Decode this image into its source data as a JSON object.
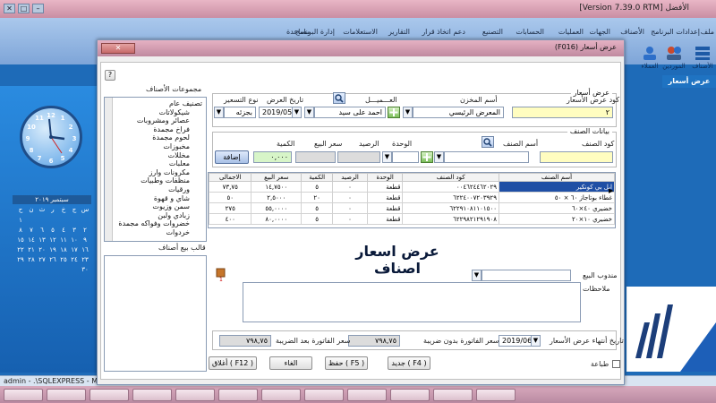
{
  "app": {
    "title": "[Version 7.39.0 RTM] الأفضل",
    "menu_items": [
      "ملف",
      "إعدادات البرنامج",
      "الأصناف",
      "الجهات",
      "العمليات",
      "الحسابات",
      "التصنيع",
      "دعم اتخاذ قرار",
      "التقارير",
      "الاستعلامات",
      "إدارة البرنامج",
      "مساعدة"
    ],
    "ribbon": [
      "الأصناف",
      "الموردين",
      "العملاء"
    ],
    "ribbon_tab": "عرض أسعار",
    "status_text": "admin  -  .\\SQLEXPRESS  -  Marke",
    "calendar": {
      "header": "سبتمبر ٢٠١٩",
      "weekdays": [
        "س",
        "ج",
        "خ",
        "ر",
        "ث",
        "ن",
        "ح"
      ],
      "days": [
        "",
        "",
        "",
        "",
        "",
        "",
        "١",
        "٢",
        "٣",
        "٤",
        "٥",
        "٦",
        "٧",
        "٨",
        "٩",
        "١٠",
        "١١",
        "١٢",
        "١٣",
        "١٤",
        "١٥",
        "١٦",
        "١٧",
        "١٨",
        "١٩",
        "٢٠",
        "٢١",
        "٢٢",
        "٢٣",
        "٢٤",
        "٢٥",
        "٢٦",
        "٢٧",
        "٢٨",
        "٢٩",
        "٣٠"
      ]
    },
    "clock_numbers": [
      "12",
      "1",
      "2",
      "3",
      "4",
      "5",
      "6",
      "7",
      "8",
      "9",
      "10",
      "11"
    ]
  },
  "dialog": {
    "title": "(F016) عرض أسعار",
    "help": "?",
    "header_group": {
      "caption": "عرض أسعار",
      "code_label": "كود عرض الأسعار",
      "code_value": "٢",
      "store_label": "أسم المخزن",
      "store_value": "المعرض الرئيسي",
      "customer_label": "العـــميـــل",
      "customer_value": "احمد على سيد",
      "date_label": "تاريخ العرض",
      "date_value": "2019/05/14",
      "pricing_label": "نوع التسعير",
      "pricing_value": "بجزئه"
    },
    "item_group": {
      "caption": "بيانات الصنف",
      "item_code_label": "كود الصنف",
      "item_name_label": "أسم الصنف",
      "unit_label": "الوحدة",
      "balance_label": "الرصيد",
      "price_label": "سعر البيع",
      "qty_label": "الكمية",
      "qty_value": "٠,٠٠٠",
      "add_button": "إضافة"
    },
    "grid": {
      "columns": [
        "أسم الصنف",
        "كود الصنف",
        "الوحدة",
        "الرصيد",
        "الكمية",
        "سعر البيع",
        "الاجمالى"
      ],
      "rows": [
        [
          "ايل بي كونكير",
          "٠٠٤٦٢٤٤٦٢٠٢٩",
          "قطعة",
          "٠",
          "٥",
          "١٤,٧٥٠٠",
          "٧٣,٧٥"
        ],
        [
          "غطاء بوتاجاز ٦٠ × ٥٠",
          "٦٢٢٤٠٠٧٢٠٣٩٢٩",
          "قطعة",
          "٠",
          "٢٠",
          "٢,٥٠٠٠",
          "٥٠"
        ],
        [
          "خضيري ٤٠×٦٠",
          "٦٢٢٩١٠٨١١٠١٥٠٠",
          "قطعة",
          "٠",
          "٥",
          "٥٥,٠٠٠٠",
          "٢٧٥"
        ],
        [
          "خضيري ١٠×٢٠",
          "٦٢٢٩٨٢١٢٩١٩٠٨",
          "قطعة",
          "٠",
          "٥",
          "٨٠,٠٠٠٠",
          "٤٠٠"
        ]
      ]
    },
    "tree": {
      "caption": "مجموعات الأصناف",
      "items": [
        "تصنيف عام",
        "شيكولاتات",
        "عصائر ومشروبات",
        "فراخ مجمدة",
        "لحوم مجمدة",
        "مخبوزات",
        "مخللات",
        "معلبات",
        "مكرونات وارز",
        "منظفات وطبيات",
        "ورقيات",
        "شاي و قهوة",
        "سمن وزيوت",
        "زبادي ولبن",
        "خضروات وفواكه مجمدة",
        "خردوات"
      ]
    },
    "price_template_caption": "قالب بيع أصناف",
    "watermark": "عرض اسعار اصناف",
    "sales_rep_label": "مندوب البيع",
    "notes_label": "ملاحظات",
    "expiry_label": "تاريخ أنتهاء عرض الأسعار",
    "expiry_value": "2019/06/14",
    "total_no_tax_label": "سعر الفاتورة  بدون ضريبة",
    "total_no_tax_value": "٧٩٨,٧٥",
    "total_tax_label": "سعر الفاتورة بعد الضريبة",
    "total_tax_value": "٧٩٨,٧٥",
    "print_label": "طباعة",
    "buttons": {
      "new": "جديد ( F4 )",
      "save": "حفظ ( F5 )",
      "cancel": "الغاء",
      "close": "أغلاق ( F12 )"
    }
  }
}
